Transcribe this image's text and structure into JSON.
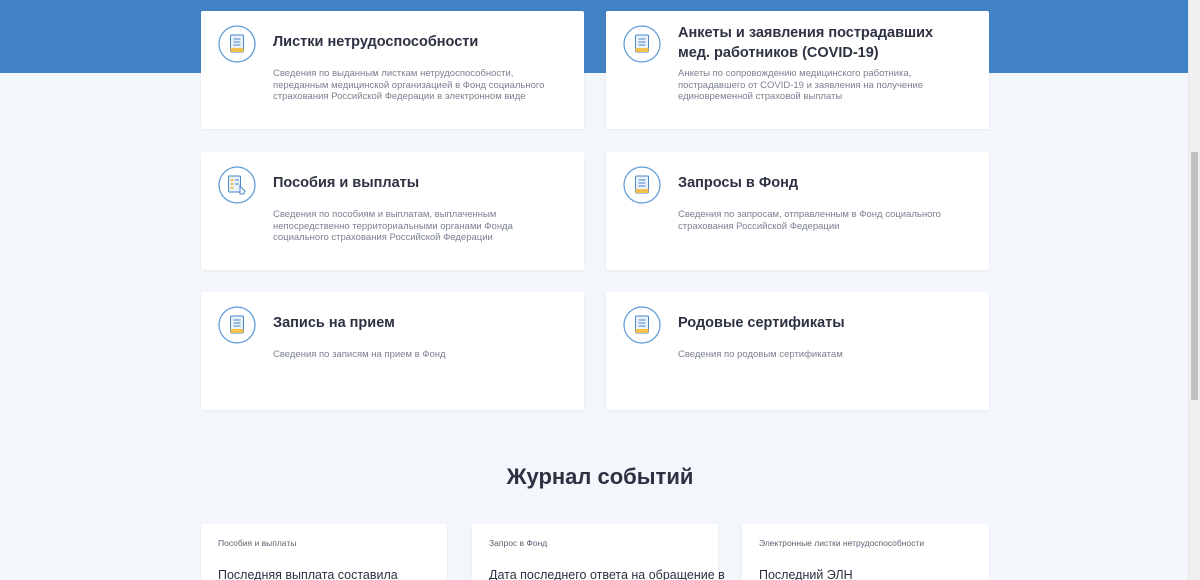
{
  "services": [
    {
      "title": "Листки нетрудоспособности",
      "description": "Сведения по выданным листкам нетрудоспособности, переданным медицинской организацией в Фонд социального страхования Российской Федерации в электронном виде",
      "icon": "document-icon"
    },
    {
      "title": "Анкеты и заявления пострадавших мед. работников (COVID-19)",
      "description": "Анкеты по сопровождению медицинского работника, пострадавшего от COVID-19 и заявления на получение единовременной страховой выплаты",
      "icon": "document-icon"
    },
    {
      "title": "Пособия и выплаты",
      "description": "Сведения по пособиям и выплатам, выплаченным непосредственно территориальными органами Фонда социального страхования Российской Федерации",
      "icon": "payment-document-icon"
    },
    {
      "title": "Запросы в Фонд",
      "description": "Сведения по запросам, отправленным в Фонд социального страхования Российской Федерации",
      "icon": "document-icon"
    },
    {
      "title": "Запись на прием",
      "description": "Сведения по записям на прием в Фонд",
      "icon": "document-icon"
    },
    {
      "title": "Родовые сертификаты",
      "description": "Сведения по родовым сертификатам",
      "icon": "document-icon"
    }
  ],
  "journal": {
    "title": "Журнал событий",
    "items": [
      {
        "category": "Пособия и выплаты",
        "text": "Последняя выплата составила"
      },
      {
        "category": "Запрос в Фонд",
        "text": "Дата последнего ответа на обращение в"
      },
      {
        "category": "Электронные листки нетрудоспособности",
        "text": "Последний ЭЛН"
      }
    ]
  },
  "colors": {
    "brand": "#4182c5",
    "background": "#f3f6fb",
    "icon_ring": "#5a9ad6",
    "icon_accent": "#f2c14e"
  }
}
